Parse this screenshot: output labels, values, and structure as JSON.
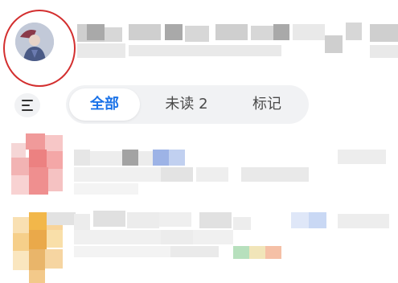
{
  "filter": {
    "tabs": [
      {
        "label": "全部",
        "active": true
      },
      {
        "label": "未读 2",
        "active": false
      },
      {
        "label": "标记",
        "active": false
      }
    ]
  },
  "colors": {
    "accent": "#1b73e8",
    "highlight_circle": "#d32f2f"
  },
  "icons": {
    "menu": "menu-icon",
    "avatar": "user-avatar"
  }
}
